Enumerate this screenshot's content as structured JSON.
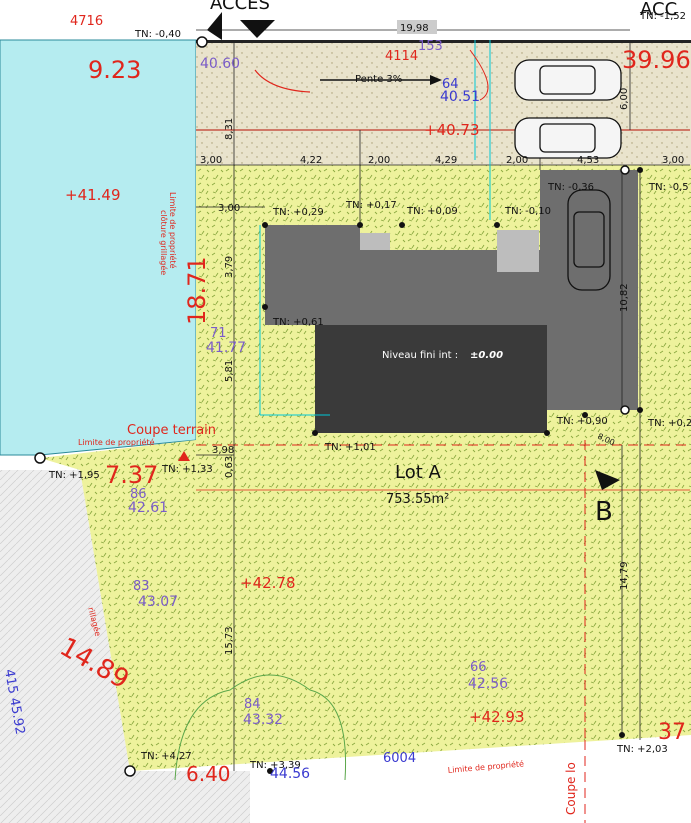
{
  "colors": {
    "plot_fill": "#eef29c",
    "hatch": "#8aa840",
    "neighbor_fill": "#b5ecf0",
    "gravel_fill": "#e9e3cc",
    "building_dark": "#3a3a3a",
    "building_grey": "#6e6e6e",
    "red": "#e0261c",
    "blue": "#3a3ad0",
    "purple": "#7a5cc8",
    "cyan": "#00c8d8"
  },
  "headers": {
    "acces_left": "ACCES",
    "acces_right": "ACC"
  },
  "lot": {
    "name": "Lot A",
    "area": "753.55m²",
    "floor_label": "Niveau fini int : ",
    "floor_value": "±0.00",
    "slope_label": "Pente 3%"
  },
  "section": {
    "label": "B",
    "coupe_terrain": "Coupe terrain",
    "coupe_side": "Coupe lo"
  },
  "tn_labels": [
    "TN: -0,40",
    "TN: -1,52",
    "TN: -0,36",
    "TN: -0,5",
    "TN: +0,29",
    "TN: +0,17",
    "TN: +0,09",
    "TN: -0,10",
    "TN: +0,61",
    "TN: +1,01",
    "TN: +0,90",
    "TN: +0,2",
    "TN: +1,95",
    "TN: +1,33",
    "TN: +4,27",
    "TN: +3,39",
    "TN: +2,03"
  ],
  "dimensions": {
    "top_19_98": "19,98",
    "row1": [
      "3,00",
      "4,22",
      "2,00",
      "4,29",
      "2,00",
      "4,53",
      "3,00"
    ],
    "row2": "3,00",
    "v_8_31": "8,31",
    "v_6_00": "6,00",
    "v_3_79": "3,79",
    "v_5_81": "5,81",
    "v_0_63": "0,63",
    "v_10_82": "10,82",
    "v_14_79": "14,79",
    "v_15_73": "15,73",
    "h_3_98": "3,98",
    "diag": "8,00"
  },
  "elevations_red": {
    "e1": "9.23",
    "e2": "39.96",
    "e3": "18.71",
    "e4": "7.37",
    "e5": "14.89",
    "e6": "6.40",
    "e7": "37",
    "e8": "+40.73",
    "e9": "+41.49",
    "e10": "+42.78",
    "e11": "+42.93",
    "e12": "4716",
    "e13": "4114"
  },
  "elevations_blue": {
    "b1": "64",
    "b2": "40.51",
    "b3": "71",
    "b4": "41.77",
    "b5": "86",
    "b6": "42.61",
    "b7": "83",
    "b8": "43.07",
    "b9": "66",
    "b10": "42.56",
    "b11": "84",
    "b12": "43.32",
    "b13": "40.60",
    "b14": "153",
    "b15": "415 45.92",
    "b16": "6004",
    "b17": "44.56"
  },
  "annotations": {
    "limite1": "Limite de propriété",
    "cloture": "clôture grillagée",
    "limite_left": "Limite de propriété",
    "limite_bottom": "Limite de propriété",
    "grillage": "rillagée"
  }
}
